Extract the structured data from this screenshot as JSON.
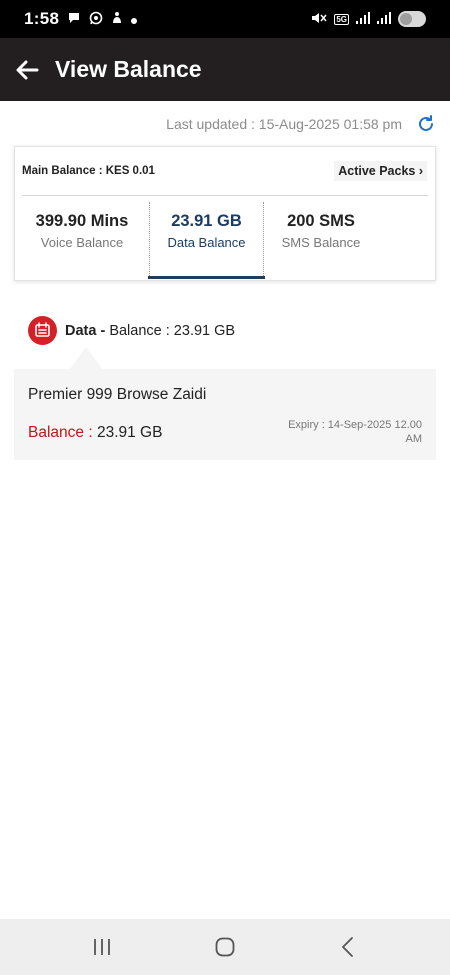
{
  "status_bar": {
    "time": "1:58",
    "network": "5G"
  },
  "app_bar": {
    "title": "View Balance",
    "back_icon": "arrow-left-icon"
  },
  "last_updated": {
    "text": "Last updated : 15-Aug-2025 01:58 pm",
    "refresh_icon": "refresh-icon",
    "accent": "#1a73c7"
  },
  "summary": {
    "main_balance": "Main Balance : KES 0.01",
    "active_packs": "Active Packs ›",
    "tabs": [
      {
        "value": "399.90 Mins",
        "label": "Voice Balance"
      },
      {
        "value": "23.91 GB",
        "label": "Data Balance"
      },
      {
        "value": "200 SMS",
        "label": "SMS Balance"
      }
    ],
    "active_tab": 1,
    "active_color": "#1d3b63"
  },
  "data_section": {
    "title_bold": "Data -",
    "title_rest": " Balance : 23.91 GB",
    "icon": "data-pack-icon",
    "icon_color": "#d42027"
  },
  "pack": {
    "name": "Premier 999 Browse Zaidi",
    "balance_label": "Balance :",
    "balance_value": " 23.91 GB",
    "expiry": "Expiry : 14-Sep-2025 12.00 AM",
    "label_color": "#c4161c"
  },
  "nav": {
    "recents_icon": "recent-apps-icon",
    "home_icon": "home-icon",
    "back_icon": "back-icon"
  }
}
